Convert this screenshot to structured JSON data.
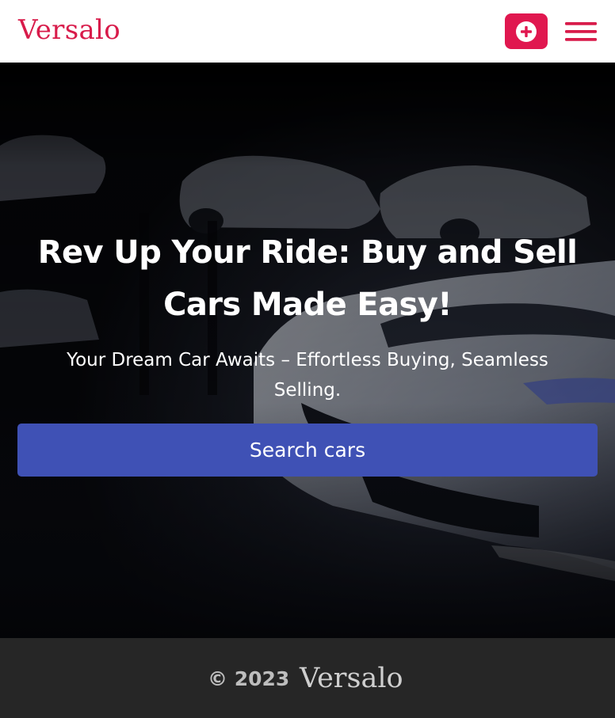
{
  "header": {
    "brand": "Versalo",
    "add_icon": "plus-circle-icon",
    "menu_icon": "hamburger-menu-icon",
    "brand_color": "#d81b4a",
    "button_color": "#e0174f"
  },
  "hero": {
    "title": "Rev Up Your Ride: Buy and Sell Cars Made Easy!",
    "subtitle": "Your Dream Car Awaits – Effortless Buying, Seamless Selling.",
    "search_button_label": "Search cars",
    "search_button_color": "#3f51b5",
    "background": "dark garage with white sports cars"
  },
  "footer": {
    "copyright": "© 2023",
    "brand": "Versalo",
    "background_color": "#262626"
  }
}
